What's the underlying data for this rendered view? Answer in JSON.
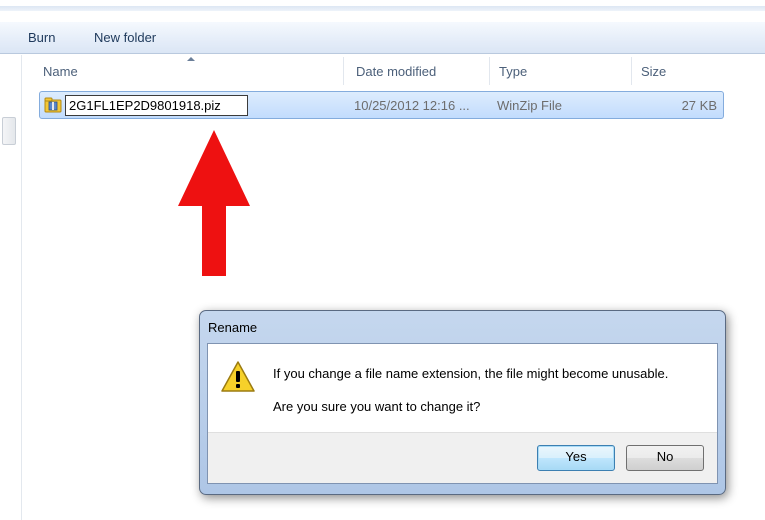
{
  "toolbar": {
    "burn_label": "Burn",
    "new_folder_label": "New folder"
  },
  "file_list": {
    "columns": [
      "Name",
      "Date modified",
      "Type",
      "Size"
    ],
    "rows": [
      {
        "name": "2G1FL1EP2D9801918.piz",
        "date_modified": "10/25/2012 12:16 ...",
        "type": "WinZip File",
        "size": "27 KB",
        "selected": true,
        "renaming": true
      }
    ],
    "sort_column": "Name",
    "sort_direction": "ascending"
  },
  "annotation": {
    "arrow_color": "#ee1111",
    "arrow_direction": "up",
    "points_to": "rename-field"
  },
  "dialog": {
    "title": "Rename",
    "icon": "warning-icon",
    "message_line1": "If you change a file name extension, the file might become unusable.",
    "message_line2": "Are you sure you want to change it?",
    "yes_label": "Yes",
    "no_label": "No",
    "default_button": "Yes"
  },
  "colors": {
    "selection": "#c2dcfd",
    "selection_border": "#84acdd",
    "dialog_frame": "#aec6e6",
    "warning_yellow": "#f6d12a"
  }
}
